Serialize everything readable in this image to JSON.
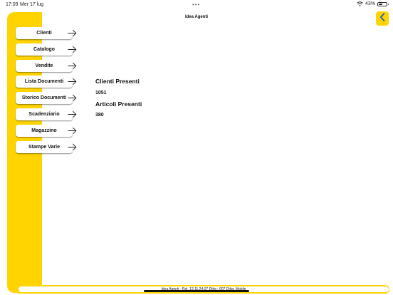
{
  "status_bar": {
    "time": "17:09",
    "date": "Mer 17 lug",
    "dots": "•••",
    "battery": "43%"
  },
  "nav": {
    "title": "Idea Agenti",
    "back_icon": "chevron-left-icon"
  },
  "colors": {
    "accent": "#ffd400",
    "background": "#ffffff"
  },
  "menu": {
    "items": [
      {
        "label": "Clienti"
      },
      {
        "label": "Catalogo"
      },
      {
        "label": "Vendite"
      },
      {
        "label": "Lista Documenti"
      },
      {
        "label": "Storico Documenti"
      },
      {
        "label": "Scadenziario"
      },
      {
        "label": "Magazzino"
      },
      {
        "label": "Stampe Varie"
      }
    ],
    "arrow_icon": "arrow-right-icon"
  },
  "info": {
    "clienti_label": "Clienti Presenti",
    "clienti_value": "1051",
    "articoli_label": "Articoli Presenti",
    "articoli_value": "380"
  },
  "footer": {
    "text": "Idea Agenti - Rel. 12.11.24.07 Ditta : 007 Ditta: Mobile"
  }
}
